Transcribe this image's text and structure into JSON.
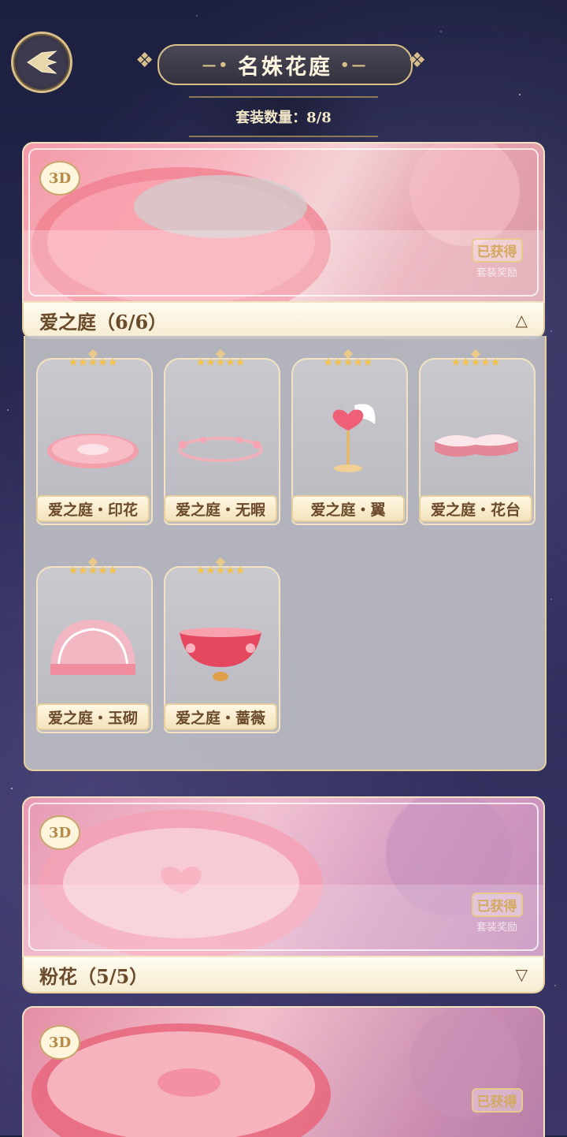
{
  "header": {
    "title": "名姝花庭",
    "count_label": "套装数量：8/8"
  },
  "sets": [
    {
      "name": "爱之庭（6/6）",
      "badge": "3D",
      "status": "已获得",
      "status_sub": "套装奖励",
      "expanded": true,
      "banner_colors": [
        "#f7a9b4",
        "#f0c6cf",
        "#e98a9a"
      ],
      "items": [
        {
          "name": "爱之庭・印花",
          "stars": "★★★★★",
          "icon": "rug-icon"
        },
        {
          "name": "爱之庭・无暇",
          "stars": "★★★★★",
          "icon": "flower-ring-icon"
        },
        {
          "name": "爱之庭・翼",
          "stars": "★★★★★",
          "icon": "winged-heart-icon"
        },
        {
          "name": "爱之庭・花台",
          "stars": "★★★★★",
          "icon": "heart-platform-icon"
        },
        {
          "name": "爱之庭・玉砌",
          "stars": "★★★★★",
          "icon": "dome-icon"
        },
        {
          "name": "爱之庭・蔷薇",
          "stars": "★★★★★",
          "icon": "rose-bowl-icon"
        }
      ]
    },
    {
      "name": "粉花（5/5）",
      "badge": "3D",
      "status": "已获得",
      "status_sub": "套装奖励",
      "expanded": false,
      "banner_colors": [
        "#e3a6c1",
        "#f2c9d8",
        "#c98ab4"
      ]
    },
    {
      "badge": "3D",
      "status": "已获得",
      "banner_colors": [
        "#e6a0b4",
        "#f3c2cf",
        "#c98aa8"
      ]
    }
  ],
  "icons": {
    "back": "back-wing-icon",
    "collapse": "chevron-up-icon",
    "expand": "chevron-down-icon"
  }
}
